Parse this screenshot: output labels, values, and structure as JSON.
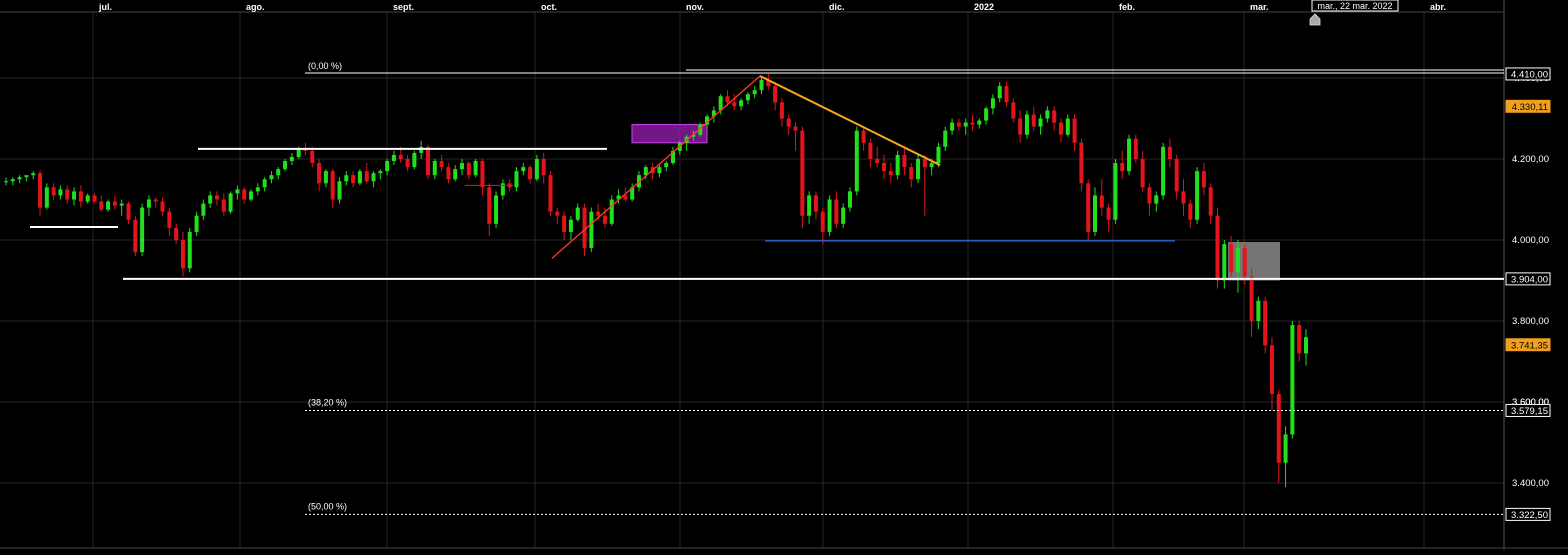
{
  "chart_data": {
    "type": "candlestick",
    "x_axis": {
      "months": [
        "jul.",
        "ago.",
        "sept.",
        "oct.",
        "nov.",
        "dic.",
        "2022",
        "feb.",
        "mar.",
        "abr."
      ],
      "cursor_date": "mar., 22 mar. 2022"
    },
    "y_axis": {
      "ylim": [
        3310,
        4560
      ],
      "ticks": [
        "4.200,00",
        "4.000,00",
        "3.800,00",
        "3.600,00",
        "3.400,00"
      ]
    },
    "price_labels": [
      {
        "value": 4410,
        "text": "4.410,00",
        "style": "white"
      },
      {
        "value": 4330.11,
        "text": "4.330,11",
        "style": "orange"
      },
      {
        "value": 3904,
        "text": "3.904,00",
        "style": "white"
      },
      {
        "value": 3741.35,
        "text": "3.741,35",
        "style": "orange"
      },
      {
        "value": 3579.15,
        "text": "3.579,15",
        "style": "white"
      },
      {
        "value": 3322.5,
        "text": "3.322,50",
        "style": "white"
      }
    ],
    "fibonacci": [
      {
        "label": "(0,00 %)",
        "value": 4410,
        "dotted": false
      },
      {
        "label": "(38,20 %)",
        "value": 3579.15,
        "dotted": true
      },
      {
        "label": "(50,00 %)",
        "value": 3322.5,
        "dotted": true
      }
    ],
    "candles": [
      [
        4145,
        4155,
        4135,
        4145
      ],
      [
        4145,
        4155,
        4135,
        4150
      ],
      [
        4150,
        4160,
        4140,
        4155
      ],
      [
        4155,
        4160,
        4145,
        4160
      ],
      [
        4160,
        4170,
        4150,
        4165
      ],
      [
        4165,
        4172,
        4060,
        4080
      ],
      [
        4080,
        4140,
        4075,
        4130
      ],
      [
        4130,
        4140,
        4100,
        4110
      ],
      [
        4110,
        4135,
        4100,
        4125
      ],
      [
        4125,
        4135,
        4090,
        4100
      ],
      [
        4100,
        4130,
        4085,
        4120
      ],
      [
        4120,
        4135,
        4080,
        4095
      ],
      [
        4095,
        4115,
        4090,
        4110
      ],
      [
        4110,
        4115,
        4090,
        4095
      ],
      [
        4095,
        4110,
        4070,
        4075
      ],
      [
        4075,
        4100,
        4070,
        4095
      ],
      [
        4095,
        4110,
        4075,
        4085
      ],
      [
        4085,
        4100,
        4060,
        4090
      ],
      [
        4090,
        4095,
        4040,
        4050
      ],
      [
        4050,
        4060,
        3960,
        3970
      ],
      [
        3970,
        4090,
        3960,
        4080
      ],
      [
        4080,
        4110,
        4060,
        4100
      ],
      [
        4100,
        4105,
        4080,
        4095
      ],
      [
        4095,
        4105,
        4060,
        4070
      ],
      [
        4070,
        4080,
        4010,
        4030
      ],
      [
        4030,
        4040,
        3990,
        4000
      ],
      [
        4000,
        4020,
        3910,
        3930
      ],
      [
        3930,
        4030,
        3920,
        4020
      ],
      [
        4020,
        4070,
        4010,
        4060
      ],
      [
        4060,
        4100,
        4050,
        4090
      ],
      [
        4090,
        4120,
        4080,
        4110
      ],
      [
        4110,
        4120,
        4085,
        4100
      ],
      [
        4100,
        4115,
        4060,
        4070
      ],
      [
        4070,
        4120,
        4065,
        4115
      ],
      [
        4115,
        4135,
        4100,
        4125
      ],
      [
        4125,
        4130,
        4090,
        4100
      ],
      [
        4100,
        4125,
        4095,
        4120
      ],
      [
        4120,
        4140,
        4110,
        4130
      ],
      [
        4130,
        4155,
        4120,
        4150
      ],
      [
        4150,
        4170,
        4140,
        4160
      ],
      [
        4160,
        4180,
        4150,
        4175
      ],
      [
        4175,
        4200,
        4170,
        4195
      ],
      [
        4195,
        4215,
        4185,
        4205
      ],
      [
        4205,
        4230,
        4200,
        4225
      ],
      [
        4225,
        4240,
        4210,
        4220
      ],
      [
        4220,
        4230,
        4180,
        4190
      ],
      [
        4190,
        4200,
        4120,
        4140
      ],
      [
        4140,
        4175,
        4130,
        4170
      ],
      [
        4170,
        4175,
        4080,
        4100
      ],
      [
        4100,
        4155,
        4090,
        4145
      ],
      [
        4145,
        4170,
        4135,
        4160
      ],
      [
        4160,
        4170,
        4130,
        4140
      ],
      [
        4140,
        4175,
        4135,
        4170
      ],
      [
        4170,
        4190,
        4140,
        4145
      ],
      [
        4145,
        4170,
        4130,
        4165
      ],
      [
        4165,
        4175,
        4150,
        4170
      ],
      [
        4170,
        4200,
        4160,
        4195
      ],
      [
        4195,
        4220,
        4185,
        4210
      ],
      [
        4210,
        4230,
        4190,
        4200
      ],
      [
        4200,
        4210,
        4170,
        4180
      ],
      [
        4180,
        4220,
        4175,
        4215
      ],
      [
        4215,
        4245,
        4200,
        4230
      ],
      [
        4230,
        4235,
        4150,
        4160
      ],
      [
        4160,
        4200,
        4150,
        4195
      ],
      [
        4195,
        4210,
        4170,
        4180
      ],
      [
        4180,
        4190,
        4140,
        4150
      ],
      [
        4150,
        4185,
        4145,
        4175
      ],
      [
        4175,
        4200,
        4160,
        4190
      ],
      [
        4190,
        4195,
        4150,
        4160
      ],
      [
        4160,
        4200,
        4155,
        4195
      ],
      [
        4195,
        4200,
        4110,
        4130
      ],
      [
        4130,
        4140,
        4010,
        4040
      ],
      [
        4040,
        4120,
        4030,
        4110
      ],
      [
        4110,
        4150,
        4100,
        4140
      ],
      [
        4140,
        4150,
        4120,
        4130
      ],
      [
        4130,
        4180,
        4120,
        4170
      ],
      [
        4170,
        4190,
        4160,
        4180
      ],
      [
        4180,
        4185,
        4140,
        4150
      ],
      [
        4150,
        4210,
        4145,
        4200
      ],
      [
        4200,
        4215,
        4140,
        4160
      ],
      [
        4160,
        4170,
        4060,
        4070
      ],
      [
        4070,
        4080,
        4040,
        4060
      ],
      [
        4060,
        4070,
        4000,
        4020
      ],
      [
        4020,
        4060,
        4000,
        4050
      ],
      [
        4050,
        4090,
        4045,
        4080
      ],
      [
        4080,
        4090,
        3960,
        3980
      ],
      [
        3980,
        4080,
        3970,
        4070
      ],
      [
        4070,
        4090,
        4050,
        4060
      ],
      [
        4060,
        4080,
        4030,
        4040
      ],
      [
        4040,
        4110,
        4035,
        4100
      ],
      [
        4100,
        4125,
        4090,
        4110
      ],
      [
        4110,
        4130,
        4095,
        4100
      ],
      [
        4100,
        4140,
        4095,
        4130
      ],
      [
        4130,
        4170,
        4120,
        4160
      ],
      [
        4160,
        4185,
        4150,
        4180
      ],
      [
        4180,
        4190,
        4150,
        4165
      ],
      [
        4165,
        4185,
        4155,
        4180
      ],
      [
        4180,
        4195,
        4170,
        4190
      ],
      [
        4190,
        4230,
        4185,
        4220
      ],
      [
        4220,
        4245,
        4210,
        4240
      ],
      [
        4240,
        4260,
        4220,
        4255
      ],
      [
        4255,
        4270,
        4245,
        4260
      ],
      [
        4260,
        4290,
        4255,
        4285
      ],
      [
        4285,
        4310,
        4280,
        4305
      ],
      [
        4305,
        4330,
        4290,
        4320
      ],
      [
        4320,
        4360,
        4310,
        4355
      ],
      [
        4355,
        4370,
        4330,
        4340
      ],
      [
        4340,
        4360,
        4320,
        4330
      ],
      [
        4330,
        4350,
        4320,
        4345
      ],
      [
        4345,
        4365,
        4335,
        4360
      ],
      [
        4360,
        4380,
        4350,
        4370
      ],
      [
        4370,
        4400,
        4360,
        4395
      ],
      [
        4395,
        4410,
        4370,
        4380
      ],
      [
        4380,
        4390,
        4320,
        4340
      ],
      [
        4340,
        4350,
        4280,
        4300
      ],
      [
        4300,
        4310,
        4260,
        4280
      ],
      [
        4280,
        4290,
        4220,
        4270
      ],
      [
        4270,
        4280,
        4030,
        4060
      ],
      [
        4060,
        4120,
        4040,
        4110
      ],
      [
        4110,
        4120,
        4050,
        4070
      ],
      [
        4070,
        4080,
        3990,
        4020
      ],
      [
        4020,
        4110,
        4010,
        4100
      ],
      [
        4100,
        4120,
        4030,
        4040
      ],
      [
        4040,
        4090,
        4030,
        4080
      ],
      [
        4080,
        4130,
        4070,
        4120
      ],
      [
        4120,
        4280,
        4110,
        4270
      ],
      [
        4270,
        4280,
        4220,
        4240
      ],
      [
        4240,
        4250,
        4180,
        4200
      ],
      [
        4200,
        4230,
        4180,
        4190
      ],
      [
        4190,
        4210,
        4150,
        4170
      ],
      [
        4170,
        4190,
        4140,
        4160
      ],
      [
        4160,
        4220,
        4150,
        4210
      ],
      [
        4210,
        4230,
        4160,
        4180
      ],
      [
        4180,
        4190,
        4130,
        4150
      ],
      [
        4150,
        4210,
        4140,
        4200
      ],
      [
        4200,
        4210,
        4060,
        4180
      ],
      [
        4180,
        4200,
        4160,
        4190
      ],
      [
        4190,
        4240,
        4180,
        4230
      ],
      [
        4230,
        4280,
        4220,
        4270
      ],
      [
        4270,
        4300,
        4260,
        4290
      ],
      [
        4290,
        4300,
        4270,
        4280
      ],
      [
        4280,
        4300,
        4260,
        4290
      ],
      [
        4290,
        4310,
        4270,
        4285
      ],
      [
        4285,
        4300,
        4275,
        4295
      ],
      [
        4295,
        4330,
        4285,
        4325
      ],
      [
        4325,
        4360,
        4310,
        4350
      ],
      [
        4350,
        4390,
        4340,
        4380
      ],
      [
        4380,
        4390,
        4330,
        4340
      ],
      [
        4340,
        4350,
        4290,
        4300
      ],
      [
        4300,
        4320,
        4240,
        4260
      ],
      [
        4260,
        4320,
        4250,
        4310
      ],
      [
        4310,
        4330,
        4270,
        4280
      ],
      [
        4280,
        4310,
        4260,
        4300
      ],
      [
        4300,
        4330,
        4290,
        4320
      ],
      [
        4320,
        4330,
        4270,
        4290
      ],
      [
        4290,
        4300,
        4240,
        4260
      ],
      [
        4260,
        4310,
        4255,
        4300
      ],
      [
        4300,
        4310,
        4220,
        4240
      ],
      [
        4240,
        4250,
        4120,
        4140
      ],
      [
        4140,
        4150,
        4000,
        4020
      ],
      [
        4020,
        4130,
        4010,
        4110
      ],
      [
        4110,
        4150,
        4060,
        4080
      ],
      [
        4080,
        4090,
        4020,
        4050
      ],
      [
        4050,
        4200,
        4040,
        4190
      ],
      [
        4190,
        4220,
        4150,
        4170
      ],
      [
        4170,
        4260,
        4160,
        4250
      ],
      [
        4250,
        4260,
        4190,
        4200
      ],
      [
        4200,
        4220,
        4120,
        4130
      ],
      [
        4130,
        4140,
        4060,
        4090
      ],
      [
        4090,
        4120,
        4070,
        4110
      ],
      [
        4110,
        4240,
        4100,
        4230
      ],
      [
        4230,
        4250,
        4180,
        4200
      ],
      [
        4200,
        4210,
        4100,
        4120
      ],
      [
        4120,
        4150,
        4060,
        4090
      ],
      [
        4090,
        4100,
        4030,
        4050
      ],
      [
        4050,
        4180,
        4040,
        4170
      ],
      [
        4170,
        4190,
        4110,
        4130
      ],
      [
        4130,
        4140,
        4040,
        4060
      ],
      [
        4060,
        4080,
        3880,
        3900
      ],
      [
        3900,
        4000,
        3880,
        3990
      ],
      [
        3990,
        4010,
        3900,
        3920
      ],
      [
        3920,
        4000,
        3870,
        3980
      ],
      [
        3980,
        3990,
        3890,
        3910
      ],
      [
        3910,
        3930,
        3760,
        3800
      ],
      [
        3800,
        3860,
        3780,
        3850
      ],
      [
        3850,
        3860,
        3720,
        3740
      ],
      [
        3740,
        3760,
        3580,
        3620
      ],
      [
        3620,
        3630,
        3400,
        3450
      ],
      [
        3450,
        3540,
        3390,
        3520
      ],
      [
        3520,
        3800,
        3510,
        3790
      ],
      [
        3790,
        3800,
        3700,
        3720
      ],
      [
        3720,
        3780,
        3690,
        3760
      ]
    ],
    "annotations": [
      {
        "type": "trend_line",
        "color": "#ff3b2f"
      },
      {
        "type": "trend_line",
        "color": "#f5a623"
      },
      {
        "type": "support_line",
        "color": "#2f5fd0",
        "value": 3998
      },
      {
        "type": "support_line",
        "color": "#ffffff",
        "value": 3904
      },
      {
        "type": "resistance_line",
        "color": "#ffffff",
        "value": 4225
      },
      {
        "type": "support_line",
        "color": "#ffffff",
        "value": 4032
      },
      {
        "type": "zone",
        "color": "#9b1fb3"
      },
      {
        "type": "zone",
        "color": "#8a8a8a"
      }
    ],
    "colors": {
      "up": "#22e01e",
      "down": "#e3141c",
      "accent": "#f0a01e",
      "grid": "#262626"
    }
  }
}
